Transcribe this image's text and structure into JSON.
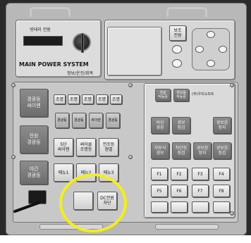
{
  "power_panel": {
    "title": "MAIN POWER SYSTEM",
    "subtitle": "밧테리 전원",
    "knob_caption": "정보/운전/회복"
  },
  "left_column": {
    "buttons": [
      "경광등\n싸이렌",
      "전원\n경광등",
      "야간\n경광등"
    ]
  },
  "top_small_row": [
    "조명",
    "조명",
    "조명",
    "조명",
    "조명"
  ],
  "center_grid": [
    [
      "경광등",
      "경광등",
      "싸이렌",
      "경광등"
    ],
    [
      "5단\n싸이렌",
      "써어클\n조명등",
      "전조등\n점멸"
    ],
    [
      "메뉴1",
      "메뉴2",
      "메뉴3"
    ],
    [
      "",
      "DC전원\n차단"
    ]
  ],
  "right_panel": {
    "brand": "(주)우리소프트",
    "top_buttons": [
      "경광\n작동중",
      "경보음\n작동중"
    ],
    "grid": [
      [
        "비상\n경광",
        "경보\n점검",
        "경보음\n정지"
      ],
      [
        "자동식\n경보",
        "차단등\n점검",
        "경보음\n정지",
        "경보음\n점검"
      ]
    ],
    "fkeys": [
      [
        "F1",
        "F2",
        "F3",
        "F4"
      ],
      [
        "F5",
        "F6",
        "F7",
        "F8"
      ]
    ]
  },
  "dpad": {
    "top_label": "보조\n전원"
  },
  "colors": {
    "highlight_ring": "#f2ee1f"
  }
}
